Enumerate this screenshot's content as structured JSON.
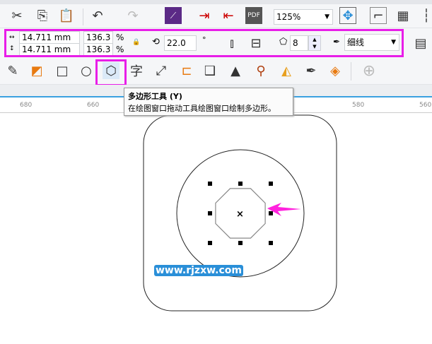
{
  "toolbar": {
    "zoom_value": "125%",
    "icons": [
      "cut-icon",
      "copy-icon",
      "paste-icon",
      "undo-icon",
      "redo-icon",
      "corel-app-launcher-icon",
      "import-icon",
      "export-icon",
      "publish-pdf-icon",
      "fullscreen-icon",
      "rulers-icon",
      "grid-icon",
      "guidelines-icon"
    ]
  },
  "property_bar": {
    "width": "14.711 mm",
    "height": "14.711 mm",
    "scale_x": "136.3",
    "scale_y": "136.3",
    "percent": "%",
    "rotation": "22.0",
    "degree": "°",
    "points": "8",
    "outline": "细线"
  },
  "toolbox": {
    "icons": [
      "freehand-icon",
      "smart-fill-icon",
      "rectangle-icon",
      "ellipse-icon",
      "polygon-icon",
      "text-icon",
      "dimension-icon",
      "connector-icon",
      "drop-shadow-icon",
      "transparency-icon",
      "eyedropper-icon",
      "interactive-fill-icon",
      "outline-pen-icon",
      "color-icon",
      "add-tool-icon"
    ]
  },
  "tooltip": {
    "title": "多边形工具 (Y)",
    "desc": "在绘图窗口拖动工具绘图窗口绘制多边形。"
  },
  "ruler": {
    "ticks": [
      "680",
      "660",
      "580",
      "560"
    ]
  },
  "watermark": "www.rjzxw.com",
  "colors": {
    "highlight": "#e81ee8",
    "arrow": "#ff22dd"
  }
}
